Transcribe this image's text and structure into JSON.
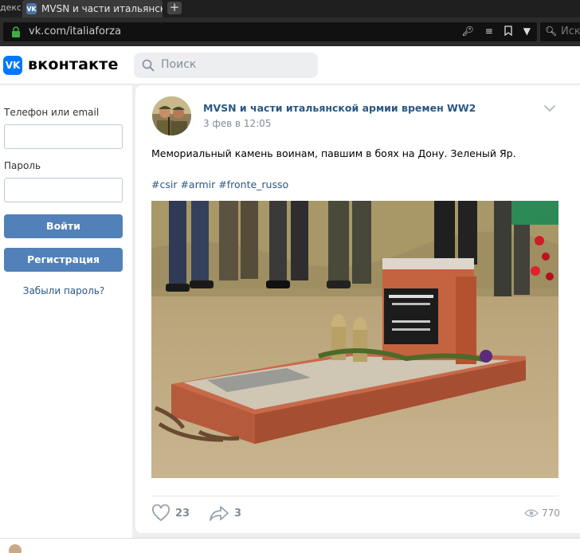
{
  "browser": {
    "prev_tab_label": "декс",
    "active_tab_title": "MVSN и части итальянско",
    "new_tab_icon": "+",
    "url": "vk.com/italiaforza",
    "search_placeholder": "Иск"
  },
  "header": {
    "logo_text": "вконтакте",
    "search_placeholder": "Поиск"
  },
  "login": {
    "phone_label": "Телефон или email",
    "password_label": "Пароль",
    "login_button": "Войти",
    "register_button": "Регистрация",
    "forgot_link": "Забыли пароль?"
  },
  "post": {
    "author": "MVSN и части итальянской армии времен WW2",
    "date": "3 фев в 12:05",
    "text": "Мемориальный камень воинам, павшим в боях на Дону. Зеленый Яр.",
    "hashtags": "#csir #armir #fronte_russo",
    "likes": "23",
    "shares": "3",
    "views": "770"
  },
  "colors": {
    "vk_blue": "#5181b8",
    "link": "#2a5885",
    "logo_blue": "#0077ff",
    "background": "#edeef0"
  }
}
